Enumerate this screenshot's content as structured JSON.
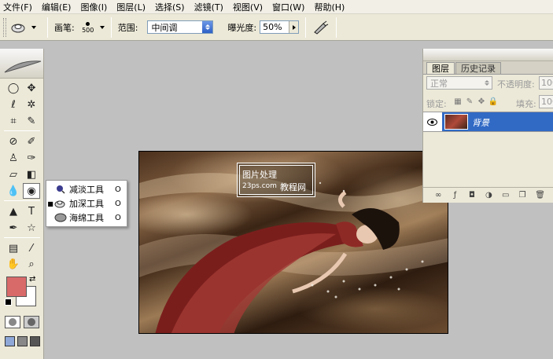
{
  "menu": [
    "文件(F)",
    "编辑(E)",
    "图像(I)",
    "图层(L)",
    "选择(S)",
    "滤镜(T)",
    "视图(V)",
    "窗口(W)",
    "帮助(H)"
  ],
  "options": {
    "brush_label": "画笔:",
    "brush_size": "500",
    "range_label": "范围:",
    "range_value": "中间调",
    "exposure_label": "曝光度:",
    "exposure_value": "50%"
  },
  "flyout": {
    "items": [
      {
        "label": "减淡工具",
        "shortcut": "O",
        "selected": false
      },
      {
        "label": "加深工具",
        "shortcut": "O",
        "selected": true
      },
      {
        "label": "海绵工具",
        "shortcut": "O",
        "selected": false
      }
    ],
    "bullet": "■"
  },
  "watermark": {
    "title": "图片处理",
    "domain": "23ps.com",
    "site": "教程网"
  },
  "layers_panel": {
    "tabs": [
      "图层",
      "历史记录"
    ],
    "blend_mode": "正常",
    "opacity_label": "不透明度:",
    "opacity_value": "100",
    "lock_label": "锁定:",
    "fill_label": "填充:",
    "fill_value": "100",
    "layer_name": "背景"
  },
  "colors": {
    "foreground": "#d96a6a",
    "background": "#ffffff",
    "selection": "#316ac5"
  }
}
